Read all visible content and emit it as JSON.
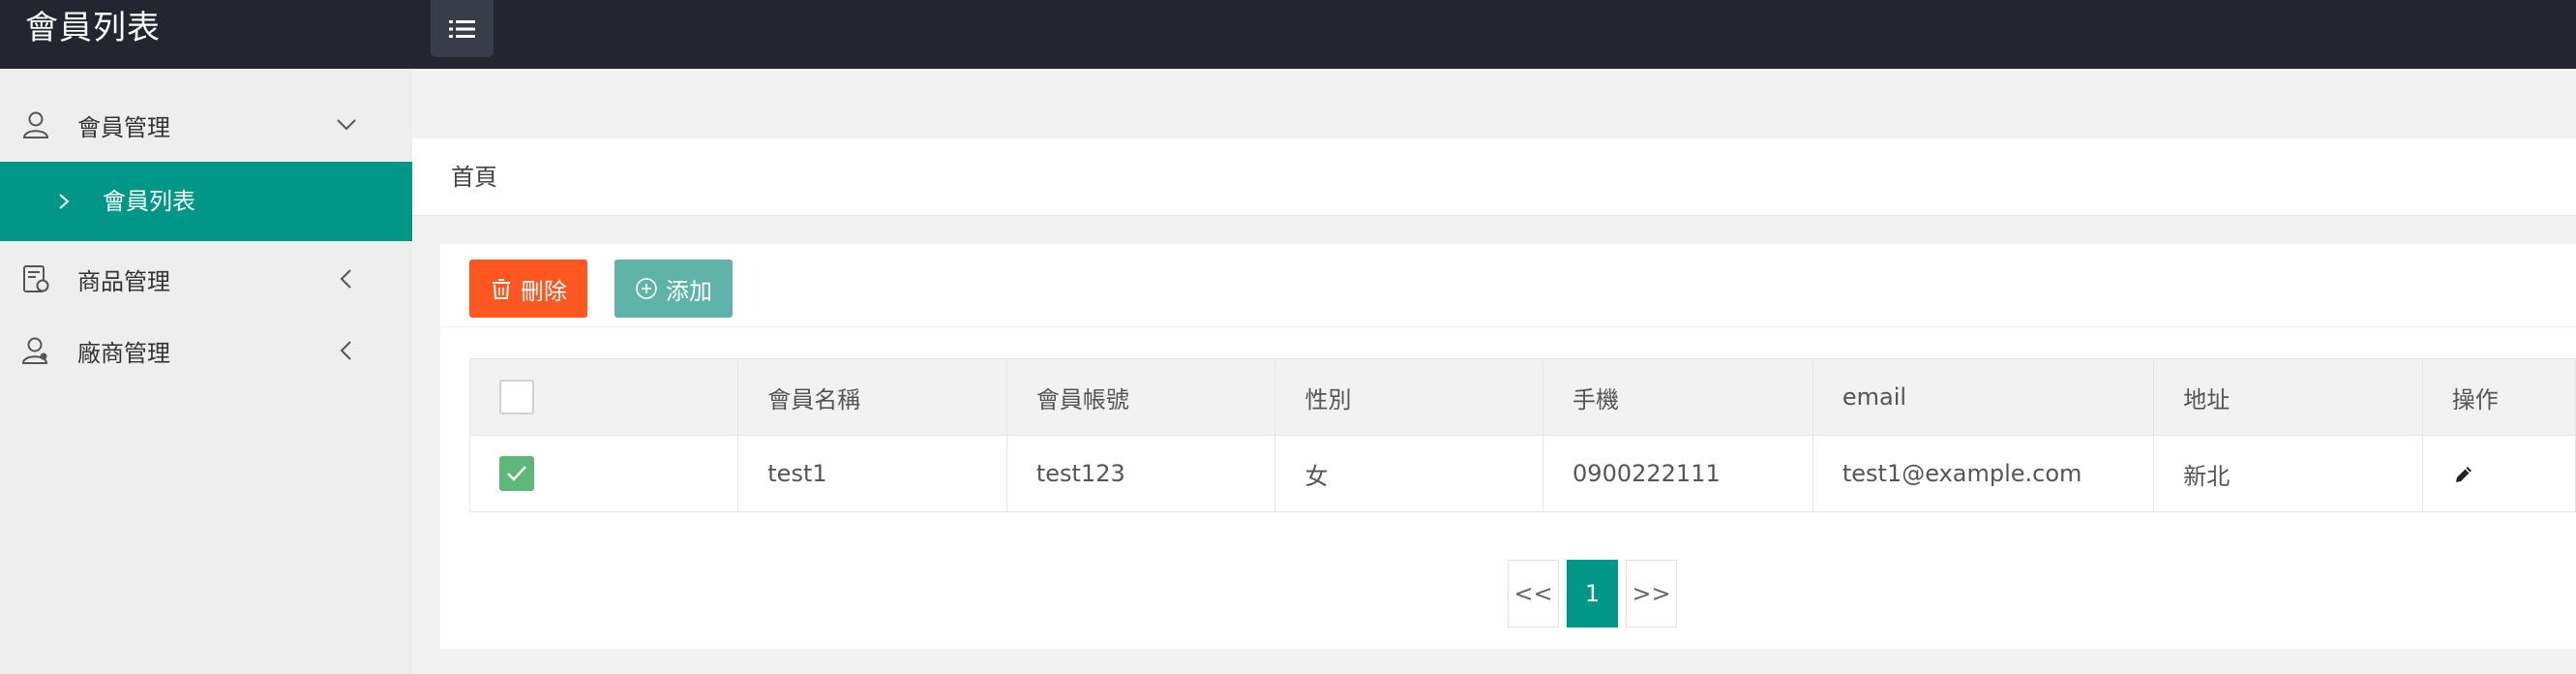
{
  "app": {
    "title": "會員列表"
  },
  "sidebar": {
    "items": [
      {
        "label": "會員管理",
        "icon": "user-icon",
        "expanded": true,
        "children": [
          {
            "label": "會員列表",
            "active": true
          }
        ]
      },
      {
        "label": "商品管理",
        "icon": "product-icon",
        "expanded": false
      },
      {
        "label": "廠商管理",
        "icon": "vendor-icon",
        "expanded": false
      }
    ]
  },
  "breadcrumb": {
    "home": "首頁"
  },
  "toolbar": {
    "delete_label": "刪除",
    "add_label": "添加"
  },
  "table": {
    "columns": [
      "",
      "會員名稱",
      "會員帳號",
      "性別",
      "手機",
      "email",
      "地址",
      "操作"
    ],
    "rows": [
      {
        "checked": true,
        "name": "test1",
        "account": "test123",
        "gender": "女",
        "phone": "0900222111",
        "email": "test1@example.com",
        "address": "新北"
      }
    ]
  },
  "pagination": {
    "prev": "<<",
    "current": "1",
    "next": ">>"
  },
  "colors": {
    "accent": "#009688",
    "danger": "#ff5722",
    "add": "#5fb3a8",
    "topbar": "#23262e"
  }
}
